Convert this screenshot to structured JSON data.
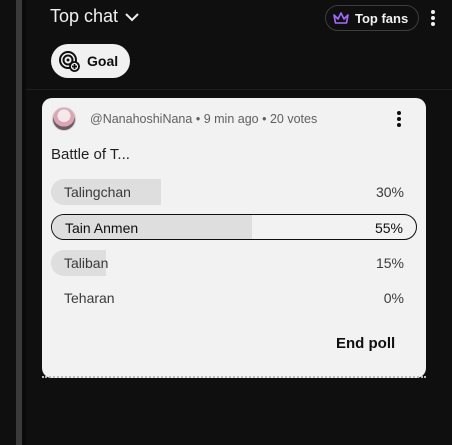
{
  "header": {
    "title": "Top chat",
    "top_fans_label": "Top fans",
    "goal_label": "Goal"
  },
  "poll": {
    "author": "@NanahoshiNana",
    "separator": "•",
    "time_ago": "9 min ago",
    "votes": "20 votes",
    "question": "Battle of T...",
    "options": [
      {
        "label": "Talingchan",
        "percent": "30%",
        "fraction": 0.3,
        "selected": false
      },
      {
        "label": "Tain Anmen",
        "percent": "55%",
        "fraction": 0.55,
        "selected": true
      },
      {
        "label": "Taliban",
        "percent": "15%",
        "fraction": 0.15,
        "selected": false
      },
      {
        "label": "Teharan",
        "percent": "0%",
        "fraction": 0.0,
        "selected": false
      }
    ],
    "end_poll_label": "End poll"
  },
  "colors": {
    "background": "#0f0f0f",
    "card": "#f2f2f2",
    "bar_fill": "#dedede",
    "top_fans_crown": "#a56bff"
  },
  "icons": [
    "chevron-down-icon",
    "crown-icon",
    "more-vert-icon",
    "goal-target-icon"
  ]
}
